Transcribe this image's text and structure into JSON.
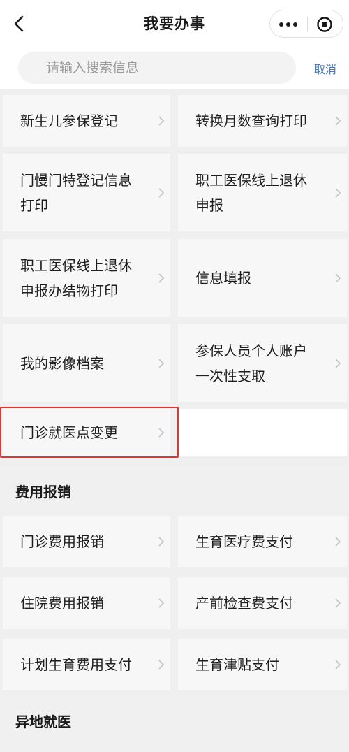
{
  "header": {
    "title": "我要办事"
  },
  "search": {
    "placeholder": "请输入搜索信息",
    "cancel_label": "取消"
  },
  "services": [
    "新生儿参保登记",
    "转换月数查询打印",
    "门慢门特登记信息打印",
    "职工医保线上退休申报",
    "职工医保线上退休申报办结物打印",
    "信息填报",
    "我的影像档案",
    "参保人员个人账户一次性支取",
    "门诊就医点变更"
  ],
  "sections": [
    {
      "title": "费用报销",
      "items": [
        "门诊费用报销",
        "生育医疗费支付",
        "住院费用报销",
        "产前检查费支付",
        "计划生育费用支付",
        "生育津贴支付"
      ]
    },
    {
      "title": "异地就医"
    }
  ],
  "colors": {
    "highlight_border": "#e23434",
    "cancel_link": "#4a78b8"
  }
}
